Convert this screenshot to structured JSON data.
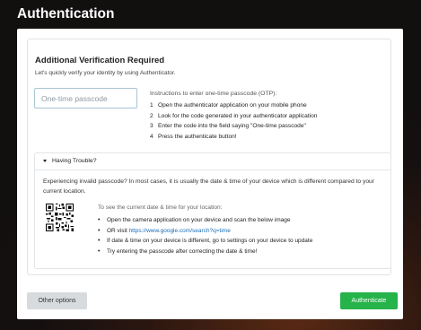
{
  "page": {
    "title": "Authentication"
  },
  "card": {
    "heading": "Additional Verification Required",
    "subtitle": "Let's quickly verify your identity by using Authenticator.",
    "otp": {
      "placeholder": "One-time passcode",
      "value": ""
    },
    "instructions": {
      "title": "Instructions to enter one-time passcode (OTP):",
      "steps": [
        {
          "num": "1",
          "text": "Open the authenticator application on your mobile phone"
        },
        {
          "num": "2",
          "text": "Look for the code generated in your authenticator application"
        },
        {
          "num": "3",
          "text": "Enter the code into the field saying \"One-time passcode\""
        },
        {
          "num": "4",
          "text": "Press the authenticate button!"
        }
      ]
    },
    "trouble": {
      "toggle_label": "Having Trouble?",
      "expanded": true,
      "description": "Experiencing invalid passcode? In most cases, it is usually the date & time of your device which is different compared to your current location.",
      "qr_icon": "qr-code-icon",
      "time_title": "To see the current date & time for your location:",
      "items": [
        {
          "text": "Open the camera application on your device and scan the below image"
        },
        {
          "prefix": "OR visit ",
          "link": "https://www.google.com/search?q=time"
        },
        {
          "text": "If date & time on your device is different, go to settings on your device to update"
        },
        {
          "text": "Try entering the passcode after correcting the date & time!"
        }
      ]
    }
  },
  "footer": {
    "other_options_label": "Other options",
    "authenticate_label": "Authenticate"
  },
  "colors": {
    "accent_green": "#25b34a",
    "link_blue": "#1a6eb8",
    "secondary_button": "#d8dbde"
  }
}
